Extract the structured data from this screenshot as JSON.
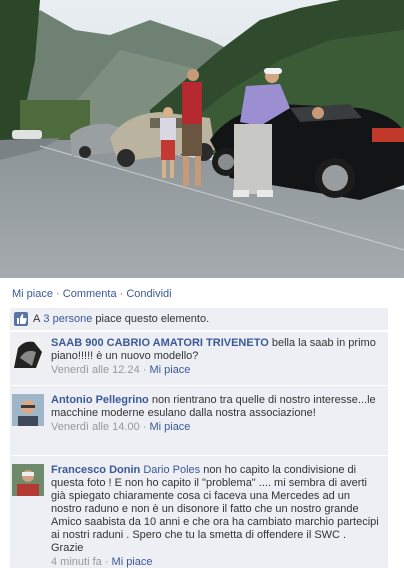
{
  "actions": {
    "like": "Mi piace",
    "comment": "Commenta",
    "share": "Condividi",
    "separator": "·"
  },
  "likes": {
    "prefix": "A",
    "people_link": "3 persone",
    "suffix": "piace questo elemento."
  },
  "comments": [
    {
      "author": "SAAB 900 CABRIO AMATORI TRIVENETO",
      "text": "bella la saab in primo piano!!!!! è un nuovo modello?",
      "time": "Venerdì alle 12.24",
      "like_label": "Mi piace"
    },
    {
      "author": "Antonio Pellegrino",
      "text": "non rientrano tra quelle di nostro interesse...le macchine moderne esulano dalla nostra associazione!",
      "time": "Venerdì alle 14.00",
      "like_label": "Mi piace"
    },
    {
      "author": "Francesco Donin",
      "mention": "Dario Poles",
      "text": "non ho capito la condivisione di questa foto ! E non ho capito il \"problema\" .... mi sembra di averti già spiegato chiaramente cosa ci faceva una Mercedes ad un nostro raduno e non è un disonore il fatto che un nostro grande Amico saabista da 10 anni e che ora ha cambiato marchio partecipi ai nostri raduni . Spero che tu la smetta di offendere il SWC . Grazie",
      "time": "4 minuti fa",
      "like_label": "Mi piace"
    }
  ],
  "colors": {
    "link": "#3b5998",
    "panel_bg": "#edeff4",
    "meta": "#999999"
  }
}
